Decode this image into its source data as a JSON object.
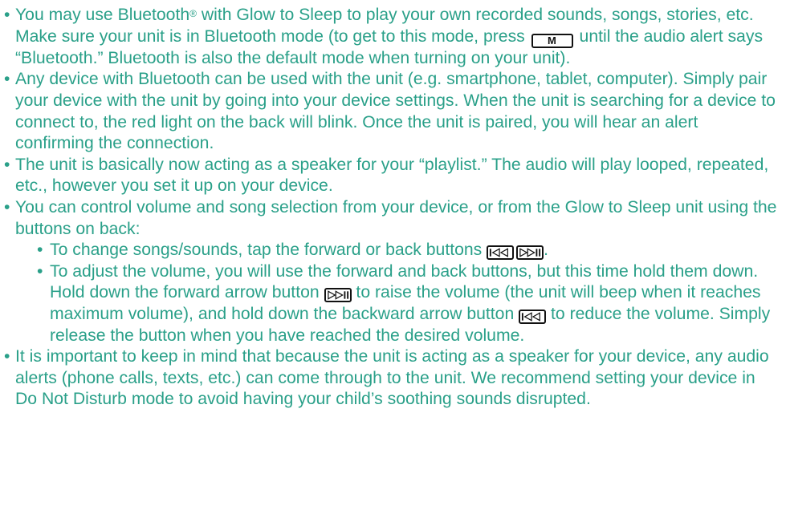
{
  "bullets": {
    "b1": {
      "t1": "You may use Bluetooth",
      "reg": "®",
      "t2": " with Glow to Sleep to play your own recorded sounds, songs, stories, etc. Make sure your unit is in Bluetooth mode (to get to this mode, press ",
      "key_m": "M",
      "t3": " until the audio alert says “Bluetooth.” Bluetooth is also the default mode when turning on your unit)."
    },
    "b2": "Any device with Bluetooth can be used with the unit (e.g. smartphone, tablet, computer). Simply pair your device with the unit by going into your device settings. When the unit is searching for a device to connect to, the red light on the back will blink. Once the unit is paired, you will hear an alert confirming the connection.",
    "b3": "The unit is basically now acting as a speaker for your “playlist.” The audio will play looped, repeated, etc., however you set it up on your device.",
    "b4": "You can control volume and song selection from your device, or from the Glow to Sleep unit using the buttons on back:",
    "sub1": {
      "t1": "To change songs/sounds, tap the forward or back buttons ",
      "t2": "."
    },
    "sub2": {
      "t1": "To adjust the volume, you will use the forward and back buttons, but this time hold them down. Hold down the forward arrow button ",
      "t2": " to raise the volume (the unit will beep when it reaches maximum volume), and hold down the backward arrow button ",
      "t3": " to reduce the volume. Simply release the button when you have reached the desired volume."
    },
    "b5": "It is important to keep in mind that because the unit is acting as a speaker for your device, any audio alerts (phone calls, texts, etc.) can come through to the unit. We recommend setting your device in Do Not Disturb mode to avoid having your child’s soothing sounds disrupted."
  },
  "icons": {
    "back": "skip-back-icon",
    "forward": "skip-forward-icon"
  },
  "colors": {
    "text": "#2aa089",
    "key_border": "#111111"
  }
}
